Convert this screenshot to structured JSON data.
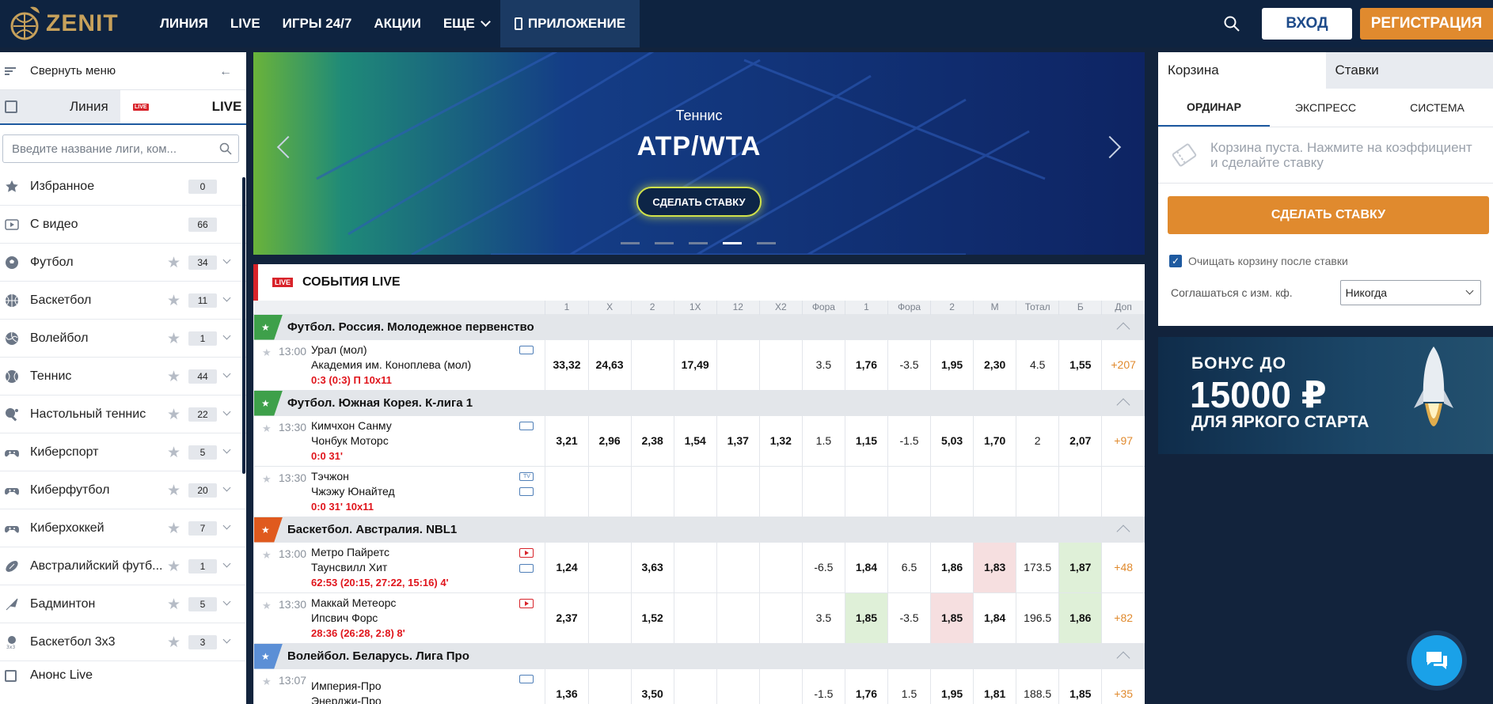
{
  "header": {
    "logo_text": "ZENIT",
    "nav": [
      "ЛИНИЯ",
      "LIVE",
      "ИГРЫ 24/7",
      "АКЦИИ",
      "ЕЩЕ"
    ],
    "app_label": "ПРИЛОЖЕНИЕ",
    "login_label": "ВХОД",
    "register_label": "РЕГИСТРАЦИЯ"
  },
  "sidebar": {
    "collapse_label": "Свернуть меню",
    "tab_line": "Линия",
    "tab_live": "LIVE",
    "live_badge": "LIVE",
    "search_placeholder": "Введите название лиги, ком...",
    "items": [
      {
        "label": "Избранное",
        "count": "0",
        "icon": "star-icon"
      },
      {
        "label": "С видео",
        "count": "66",
        "icon": "video-icon"
      },
      {
        "label": "Футбол",
        "count": "34",
        "icon": "football-icon"
      },
      {
        "label": "Баскетбол",
        "count": "11",
        "icon": "basketball-icon"
      },
      {
        "label": "Волейбол",
        "count": "1",
        "icon": "volleyball-icon"
      },
      {
        "label": "Теннис",
        "count": "44",
        "icon": "tennis-icon"
      },
      {
        "label": "Настольный теннис",
        "count": "22",
        "icon": "table-tennis-icon"
      },
      {
        "label": "Киберспорт",
        "count": "5",
        "icon": "gamepad-icon"
      },
      {
        "label": "Киберфутбол",
        "count": "20",
        "icon": "gamepad-icon"
      },
      {
        "label": "Киберхоккей",
        "count": "7",
        "icon": "gamepad-icon"
      },
      {
        "label": "Австралийский футб...",
        "count": "1",
        "icon": "rugby-ball-icon"
      },
      {
        "label": "Бадминтон",
        "count": "5",
        "icon": "shuttlecock-icon"
      },
      {
        "label": "Баскетбол 3х3",
        "count": "3",
        "icon": "basketball-3x3-icon"
      }
    ],
    "anons_label": "Анонс Live"
  },
  "banner": {
    "subtitle": "Теннис",
    "title": "ATP/WTA",
    "button": "СДЕЛАТЬ СТАВКУ",
    "dots": 5,
    "active_dot": 3
  },
  "live": {
    "badge": "LIVE",
    "title": "СОБЫТИЯ LIVE",
    "columns": [
      "1",
      "X",
      "2",
      "1X",
      "12",
      "X2",
      "Фора",
      "1",
      "Фора",
      "2",
      "М",
      "Тотал",
      "Б",
      "Доп"
    ],
    "rows": [
      {
        "type": "league",
        "name": "Футбол. Россия. Молодежное первенство",
        "flag": "#3ea04a",
        "flag_star": "★"
      },
      {
        "type": "match",
        "time": "13:00",
        "team1": "Урал (мол)",
        "team2": "Академия им. Коноплева (мол)",
        "score": "0:3 (0:3) П 10x11",
        "icons": [
          "stat"
        ],
        "odds": [
          "33,32",
          "24,63",
          "",
          "17,49",
          "",
          "",
          "3.5",
          "1,76",
          "-3.5",
          "1,95",
          "2,30",
          "4.5",
          "1,55",
          "+207"
        ],
        "hl": {}
      },
      {
        "type": "league",
        "name": "Футбол. Южная Корея. К-лига 1",
        "flag": "#3ea04a",
        "flag_star": "★"
      },
      {
        "type": "match",
        "time": "13:30",
        "team1": "Кимчхон Санму",
        "team2": "Чонбук Моторс",
        "score": "0:0 31'",
        "icons": [
          "stat"
        ],
        "odds": [
          "3,21",
          "2,96",
          "2,38",
          "1,54",
          "1,37",
          "1,32",
          "1.5",
          "1,15",
          "-1.5",
          "5,03",
          "1,70",
          "2",
          "2,07",
          "+97"
        ],
        "hl": {}
      },
      {
        "type": "match",
        "time": "13:30",
        "team1": "Тэчжон",
        "team2": "Чжэжу Юнайтед",
        "score": "0:0 31' 10x11",
        "icons": [
          "tv",
          "stat"
        ],
        "odds": [
          "",
          "",
          "",
          "",
          "",
          "",
          "",
          "",
          "",
          "",
          "",
          "",
          "",
          ""
        ],
        "hl": {}
      },
      {
        "type": "league",
        "name": "Баскетбол. Австралия. NBL1",
        "flag": "#e05a1e",
        "flag_star": "★"
      },
      {
        "type": "match",
        "time": "13:00",
        "team1": "Метро Пайретс",
        "team2": "Таунсвилл Хит",
        "score": "62:53 (20:15, 27:22, 15:16) 4'",
        "icons": [
          "play",
          "stat"
        ],
        "odds": [
          "1,24",
          "",
          "3,63",
          "",
          "",
          "",
          "-6.5",
          "1,84",
          "6.5",
          "1,86",
          "1,83",
          "173.5",
          "1,87",
          "+48"
        ],
        "hl": {
          "10": "r",
          "12": "g"
        }
      },
      {
        "type": "match",
        "time": "13:30",
        "team1": "Маккай Метеорс",
        "team2": "Ипсвич Форс",
        "score": "28:36 (26:28, 2:8) 8'",
        "icons": [
          "play"
        ],
        "odds": [
          "2,37",
          "",
          "1,52",
          "",
          "",
          "",
          "3.5",
          "1,85",
          "-3.5",
          "1,85",
          "1,84",
          "196.5",
          "1,86",
          "+82"
        ],
        "hl": {
          "7": "g",
          "9": "r",
          "12": "g"
        }
      },
      {
        "type": "league",
        "name": "Волейбол. Беларусь. Лига Про",
        "flag": "#5b8fd6",
        "flag_star": "★"
      },
      {
        "type": "match",
        "time": "13:07",
        "team1": "Империя-Про",
        "team2": "Энерджи-Про",
        "score": "",
        "icons": [
          "stat"
        ],
        "odds": [
          "1,36",
          "",
          "3,50",
          "",
          "",
          "",
          "-1.5",
          "1,76",
          "1.5",
          "1,95",
          "1,81",
          "188.5",
          "1,85",
          "+35"
        ],
        "hl": {}
      }
    ]
  },
  "slip": {
    "tab_cart": "Корзина",
    "tab_bets": "Ставки",
    "sub": [
      "ОРДИНАР",
      "ЭКСПРЕСС",
      "СИСТЕМА"
    ],
    "empty_text": "Корзина пуста. Нажмите на коэффициент и сделайте ставку",
    "button": "СДЕЛАТЬ СТАВКУ",
    "clear_label": "Очищать корзину после ставки",
    "agree_label": "Соглашаться с изм. кф.",
    "agree_value": "Никогда"
  },
  "promo": {
    "line1": "БОНУС ДО",
    "line2": "15000 ₽",
    "line3": "ДЛЯ ЯРКОГО СТАРТА"
  },
  "colors": {
    "header_bg": "#0e2340",
    "accent_orange": "#e08a2e",
    "live_red": "#d8232a",
    "brand_gold": "#c7a15b"
  }
}
